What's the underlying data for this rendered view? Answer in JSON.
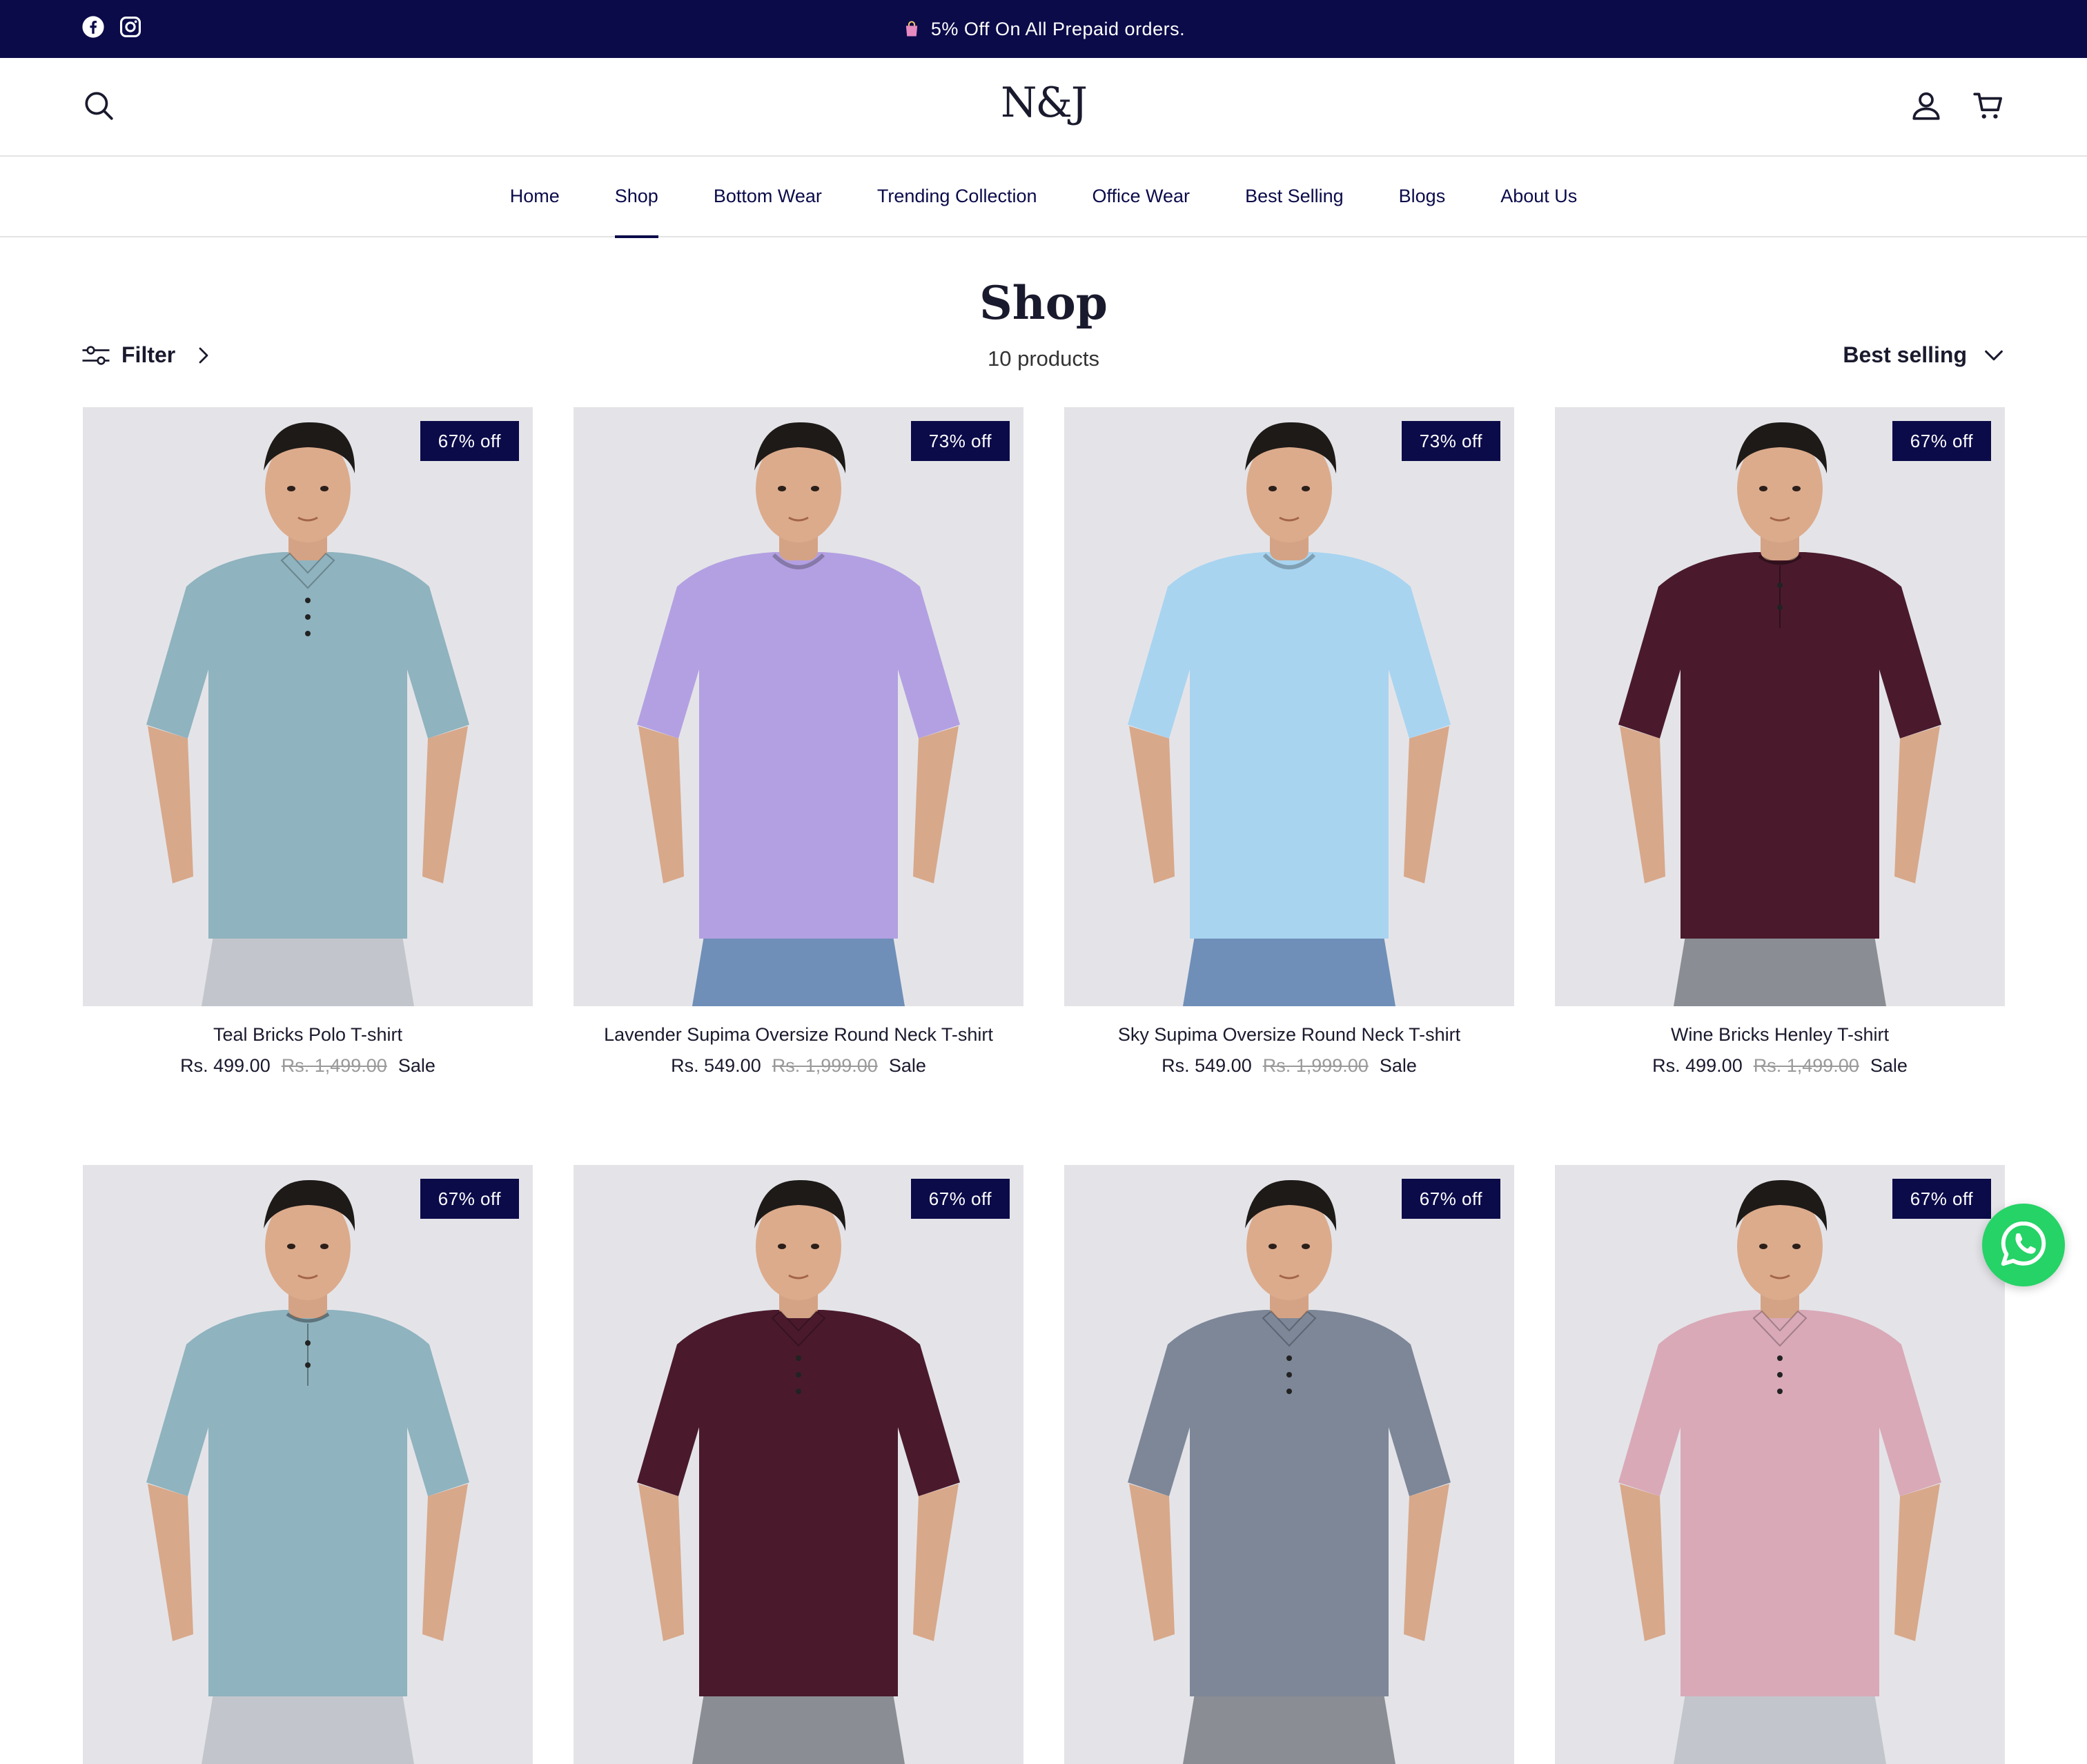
{
  "announcement": {
    "message": "5% Off On All Prepaid orders.",
    "social": [
      "facebook-icon",
      "instagram-icon"
    ]
  },
  "header": {
    "logo": "N&J",
    "icons": [
      "search-icon",
      "account-icon",
      "cart-icon"
    ]
  },
  "nav": {
    "items": [
      {
        "label": "Home",
        "active": false
      },
      {
        "label": "Shop",
        "active": true
      },
      {
        "label": "Bottom Wear",
        "active": false
      },
      {
        "label": "Trending Collection",
        "active": false
      },
      {
        "label": "Office Wear",
        "active": false
      },
      {
        "label": "Best Selling",
        "active": false
      },
      {
        "label": "Blogs",
        "active": false
      },
      {
        "label": "About Us",
        "active": false
      }
    ]
  },
  "page": {
    "title": "Shop",
    "count": "10 products",
    "filter_label": "Filter",
    "sort_label": "Best selling"
  },
  "colors": {
    "brand_navy": "#0b0b4a",
    "whatsapp_green": "#25d366"
  },
  "products": [
    {
      "name": "Teal Bricks Polo T-shirt",
      "price": "Rs. 499.00",
      "compare": "Rs. 1,499.00",
      "sale": "Sale",
      "badge": "67% off",
      "shirt": "#8fb3bf",
      "collar": "polo",
      "pants": "#c2c6cc"
    },
    {
      "name": "Lavender Supima Oversize Round Neck T-shirt",
      "price": "Rs. 549.00",
      "compare": "Rs. 1,999.00",
      "sale": "Sale",
      "badge": "73% off",
      "shirt": "#b3a0e2",
      "collar": "round",
      "pants": "#6f8fb8"
    },
    {
      "name": "Sky Supima Oversize Round Neck T-shirt",
      "price": "Rs. 549.00",
      "compare": "Rs. 1,999.00",
      "sale": "Sale",
      "badge": "73% off",
      "shirt": "#a8d4f0",
      "collar": "round",
      "pants": "#6f8fb8"
    },
    {
      "name": "Wine Bricks Henley T-shirt",
      "price": "Rs. 499.00",
      "compare": "Rs. 1,499.00",
      "sale": "Sale",
      "badge": "67% off",
      "shirt": "#4a1a2c",
      "collar": "henley",
      "pants": "#8a8e94"
    },
    {
      "name": "",
      "price": "",
      "compare": "",
      "sale": "",
      "badge": "67% off",
      "shirt": "#8fb3bf",
      "collar": "henley",
      "pants": "#c2c6cc"
    },
    {
      "name": "",
      "price": "",
      "compare": "",
      "sale": "",
      "badge": "67% off",
      "shirt": "#4a1a2c",
      "collar": "polo",
      "pants": "#8a8e94"
    },
    {
      "name": "",
      "price": "",
      "compare": "",
      "sale": "",
      "badge": "67% off",
      "shirt": "#7d8798",
      "collar": "polo",
      "pants": "#8a8e94"
    },
    {
      "name": "",
      "price": "",
      "compare": "",
      "sale": "",
      "badge": "67% off",
      "shirt": "#d9a9b8",
      "collar": "polo",
      "pants": "#c2c6cc"
    }
  ]
}
